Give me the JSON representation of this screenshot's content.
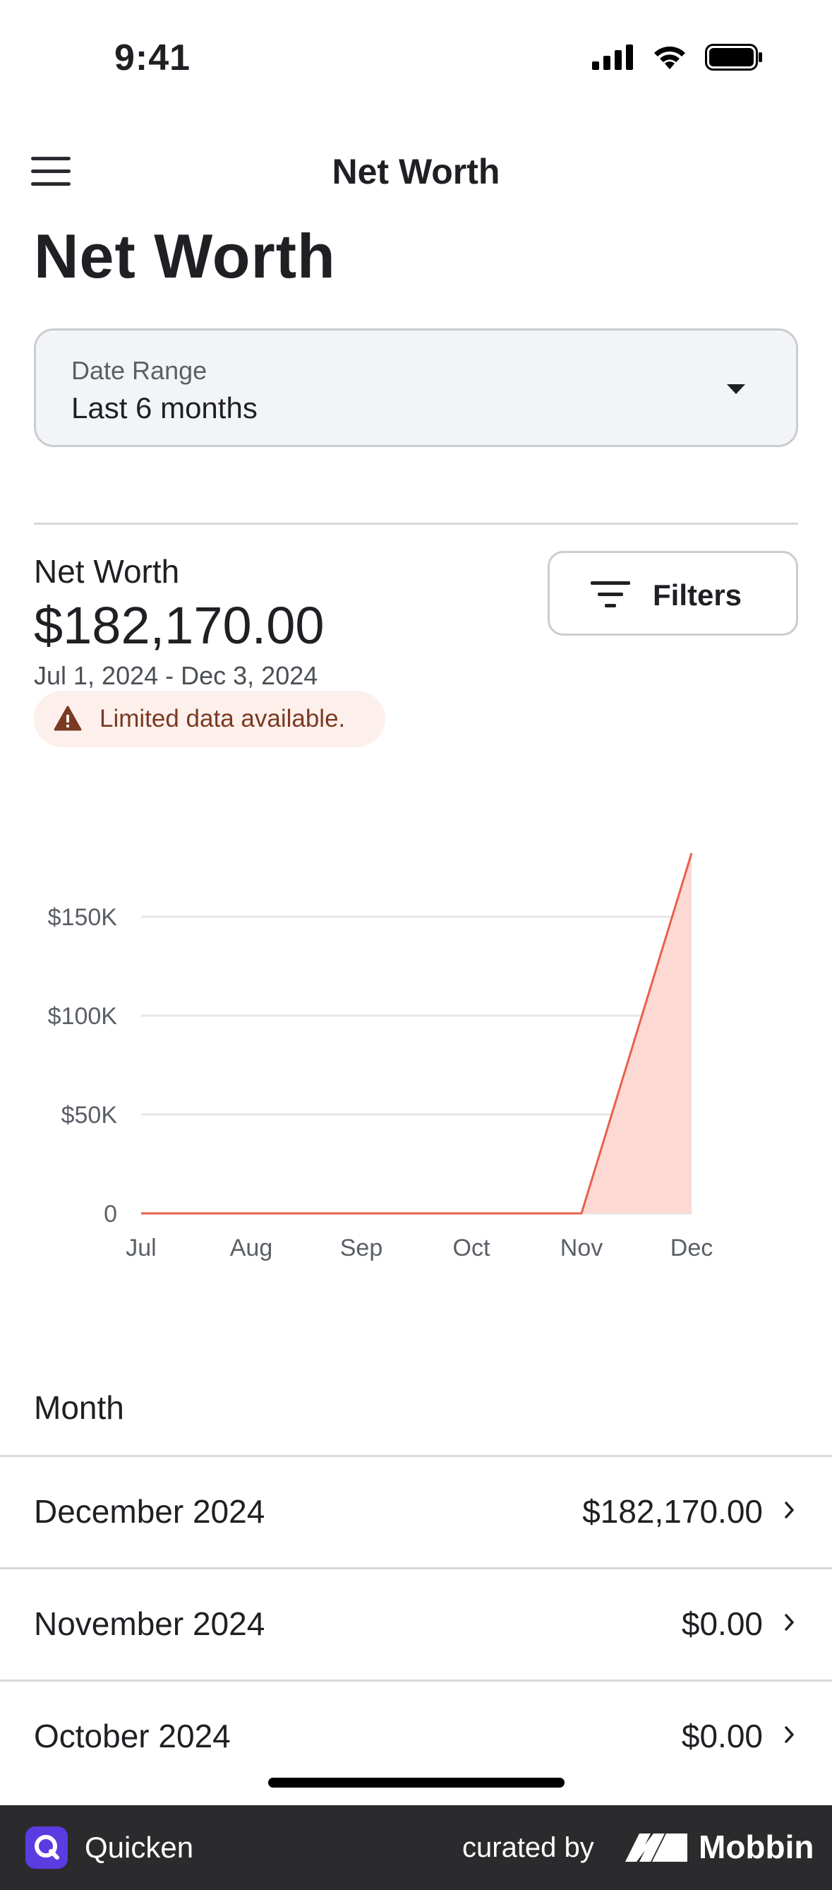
{
  "status_bar": {
    "time": "9:41"
  },
  "nav": {
    "title": "Net Worth"
  },
  "page": {
    "title": "Net Worth"
  },
  "date_range": {
    "label": "Date Range",
    "value": "Last 6 months"
  },
  "summary": {
    "label": "Net Worth",
    "value": "$182,170.00",
    "range": "Jul 1, 2024 - Dec 3, 2024",
    "warning": "Limited data available."
  },
  "filters": {
    "label": "Filters"
  },
  "colors": {
    "line": "#e8604c",
    "fill": "#fdd9d3",
    "grid": "#e6e7ea"
  },
  "chart_data": {
    "type": "area",
    "x": [
      "Jul",
      "Aug",
      "Sep",
      "Oct",
      "Nov",
      "Dec"
    ],
    "series": [
      {
        "values": [
          0,
          0,
          0,
          0,
          0,
          182170
        ]
      }
    ],
    "yticks": [
      "0",
      "$50K",
      "$100K",
      "$150K"
    ],
    "ylim": [
      0,
      182170
    ],
    "grid": true
  },
  "table": {
    "header": "Month",
    "rows": [
      {
        "month": "December 2024",
        "value": "$182,170.00"
      },
      {
        "month": "November 2024",
        "value": "$0.00"
      },
      {
        "month": "October 2024",
        "value": "$0.00"
      }
    ]
  },
  "footer": {
    "app_name": "Quicken",
    "curated_by": "curated by",
    "brand": "Mobbin"
  }
}
